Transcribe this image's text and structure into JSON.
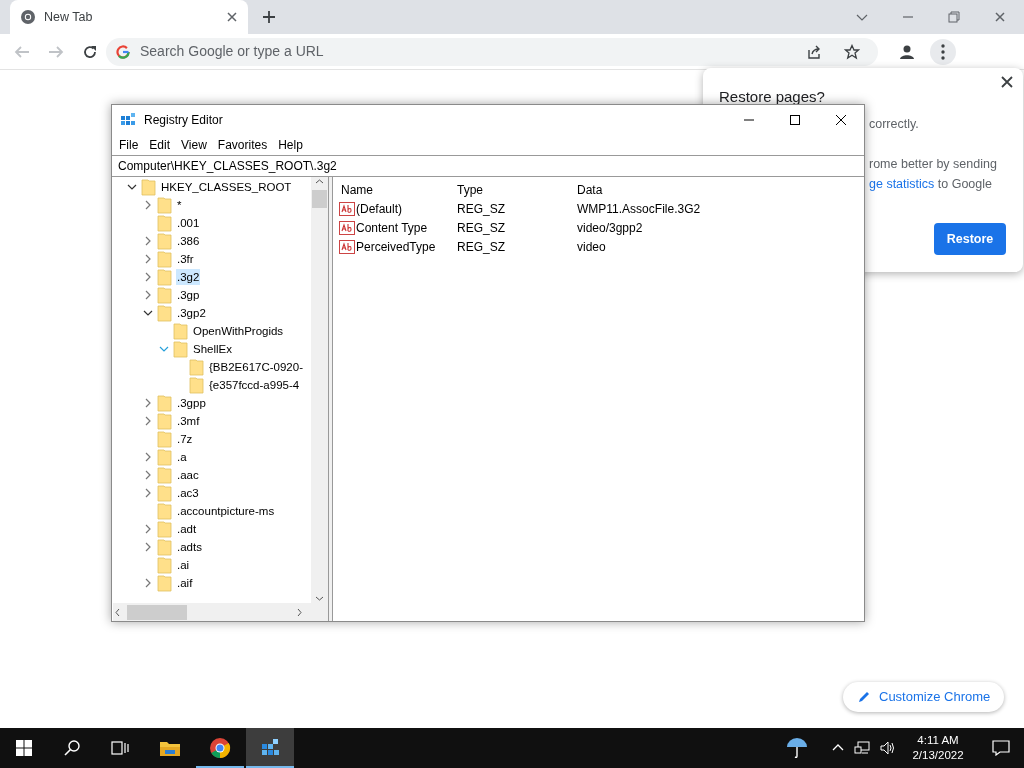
{
  "browser": {
    "tab": {
      "title": "New Tab",
      "selected": true
    },
    "omnibox": {
      "placeholder": "Search Google or type a URL"
    }
  },
  "restore_popup": {
    "title": "Restore pages?",
    "lines": [
      {
        "text": "correctly."
      },
      {
        "text": "rome better by sending"
      },
      {
        "link": "ge statistics",
        "text": " to Google"
      }
    ],
    "button": "Restore"
  },
  "customize_button": "Customize Chrome",
  "registry_editor": {
    "title": "Registry Editor",
    "menu": [
      "File",
      "Edit",
      "View",
      "Favorites",
      "Help"
    ],
    "address": "Computer\\HKEY_CLASSES_ROOT\\.3g2",
    "tree": [
      {
        "label": "HKEY_CLASSES_ROOT",
        "expandable": true,
        "expanded": true,
        "selected": false,
        "children": [
          {
            "label": "*",
            "expandable": true,
            "expanded": false,
            "selected": false
          },
          {
            "label": ".001",
            "expandable": false,
            "selected": false
          },
          {
            "label": ".386",
            "expandable": true,
            "expanded": false,
            "selected": false
          },
          {
            "label": ".3fr",
            "expandable": true,
            "expanded": false,
            "selected": false
          },
          {
            "label": ".3g2",
            "expandable": true,
            "expanded": false,
            "selected": true
          },
          {
            "label": ".3gp",
            "expandable": true,
            "expanded": false,
            "selected": false
          },
          {
            "label": ".3gp2",
            "expandable": true,
            "expanded": true,
            "selected": false,
            "children": [
              {
                "label": "OpenWithProgids",
                "expandable": false,
                "selected": false
              },
              {
                "label": "ShellEx",
                "expandable": true,
                "expanded": true,
                "selected": false,
                "children": [
                  {
                    "label": "{BB2E617C-0920-",
                    "expandable": false,
                    "selected": false
                  },
                  {
                    "label": "{e357fccd-a995-4",
                    "expandable": false,
                    "selected": false
                  }
                ]
              }
            ]
          },
          {
            "label": ".3gpp",
            "expandable": true,
            "expanded": false,
            "selected": false
          },
          {
            "label": ".3mf",
            "expandable": true,
            "expanded": false,
            "selected": false
          },
          {
            "label": ".7z",
            "expandable": false,
            "selected": false
          },
          {
            "label": ".a",
            "expandable": true,
            "expanded": false,
            "selected": false
          },
          {
            "label": ".aac",
            "expandable": true,
            "expanded": false,
            "selected": false
          },
          {
            "label": ".ac3",
            "expandable": true,
            "expanded": false,
            "selected": false
          },
          {
            "label": ".accountpicture-ms",
            "expandable": false,
            "selected": false
          },
          {
            "label": ".adt",
            "expandable": true,
            "expanded": false,
            "selected": false
          },
          {
            "label": ".adts",
            "expandable": true,
            "expanded": false,
            "selected": false
          },
          {
            "label": ".ai",
            "expandable": false,
            "selected": false
          },
          {
            "label": ".aif",
            "expandable": true,
            "expanded": false,
            "selected": false
          }
        ]
      }
    ],
    "columns": [
      "Name",
      "Type",
      "Data"
    ],
    "values": [
      {
        "name": "(Default)",
        "type": "REG_SZ",
        "data": "WMP11.AssocFile.3G2"
      },
      {
        "name": "Content Type",
        "type": "REG_SZ",
        "data": "video/3gpp2"
      },
      {
        "name": "PerceivedType",
        "type": "REG_SZ",
        "data": "video"
      }
    ]
  },
  "taskbar": {
    "apps": [
      {
        "kind": "explorer",
        "running": false,
        "active": false
      },
      {
        "kind": "chrome",
        "running": true,
        "active": false
      },
      {
        "kind": "regedit",
        "running": true,
        "active": true
      }
    ],
    "time": "4:11 AM",
    "date": "2/13/2022"
  }
}
